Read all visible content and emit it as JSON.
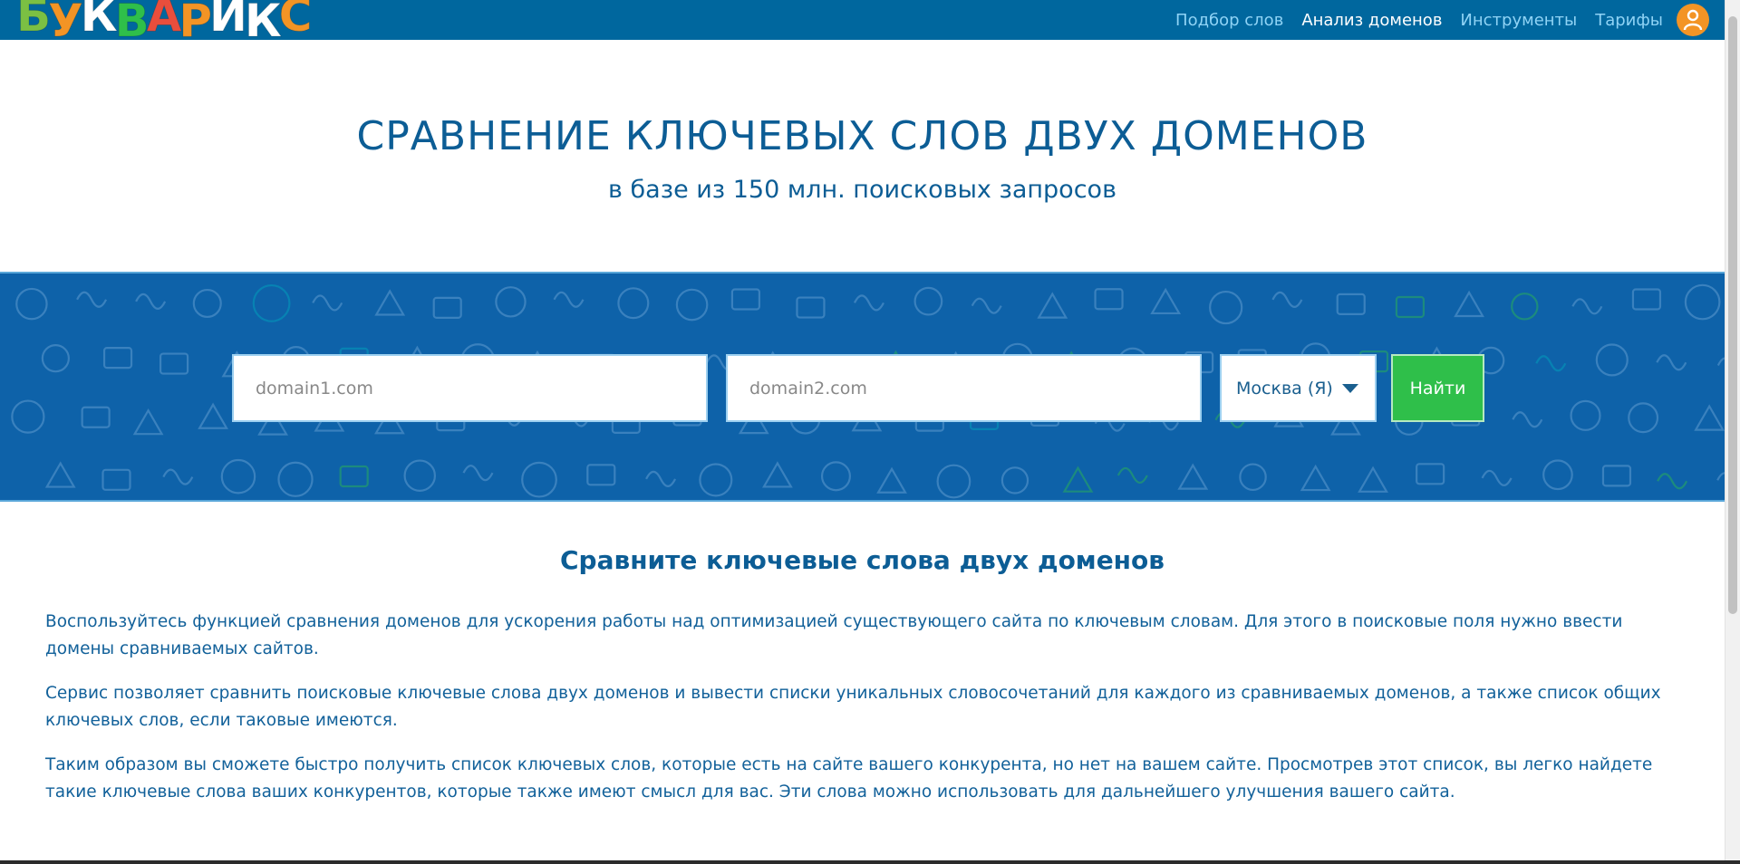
{
  "brand": {
    "logo_text": "БУКВАРИКС",
    "logo_letters": [
      {
        "ch": "Б",
        "color": "#7bc043"
      },
      {
        "ch": "У",
        "color": "#f39425"
      },
      {
        "ch": "К",
        "color": "#ffffff"
      },
      {
        "ch": "В",
        "color": "#2fbf4a"
      },
      {
        "ch": "А",
        "color": "#e94e3c"
      },
      {
        "ch": "Р",
        "color": "#f39425"
      },
      {
        "ch": "И",
        "color": "#ffffff"
      },
      {
        "ch": "К",
        "color": "#ffffff"
      },
      {
        "ch": "С",
        "color": "#f39425"
      }
    ]
  },
  "nav": {
    "items": [
      {
        "label": "Подбор слов",
        "active": false
      },
      {
        "label": "Анализ доменов",
        "active": true
      },
      {
        "label": "Инструменты",
        "active": false
      },
      {
        "label": "Тарифы",
        "active": false
      }
    ],
    "user_icon": "user-icon"
  },
  "hero": {
    "title": "СРАВНЕНИЕ КЛЮЧЕВЫХ СЛОВ ДВУХ ДОМЕНОВ",
    "subtitle": "в базе из 150 млн. поисковых запросов"
  },
  "search": {
    "domain1_placeholder": "domain1.com",
    "domain1_value": "",
    "domain2_placeholder": "domain2.com",
    "domain2_value": "",
    "region_selected": "Москва (Я)",
    "submit_label": "Найти"
  },
  "content": {
    "title": "Сравните ключевые слова двух доменов",
    "paragraphs": [
      "Воспользуйтесь функцией сравнения доменов для ускорения работы над оптимизацией существующего сайта по ключевым словам. Для этого в поисковые поля нужно ввести домены сравниваемых сайтов.",
      "Сервис позволяет сравнить поисковые ключевые слова двух доменов и вывести списки уникальных словосочетаний для каждого из сравниваемых доменов, а также список общих ключевых слов, если таковые имеются.",
      "Таким образом вы сможете быстро получить список ключевых слов, которые есть на сайте вашего конкурента, но нет на вашем сайте. Просмотрев этот список, вы легко найдете такие ключевые слова ваших конкурентов, которые также имеют смысл для вас. Эти слова можно использовать для дальнейшего улучшения вашего сайта."
    ]
  },
  "colors": {
    "topbar": "#00679e",
    "band": "#0e62a9",
    "accent_green": "#2fbf4a",
    "accent_orange": "#f39425",
    "text": "#12619a"
  }
}
